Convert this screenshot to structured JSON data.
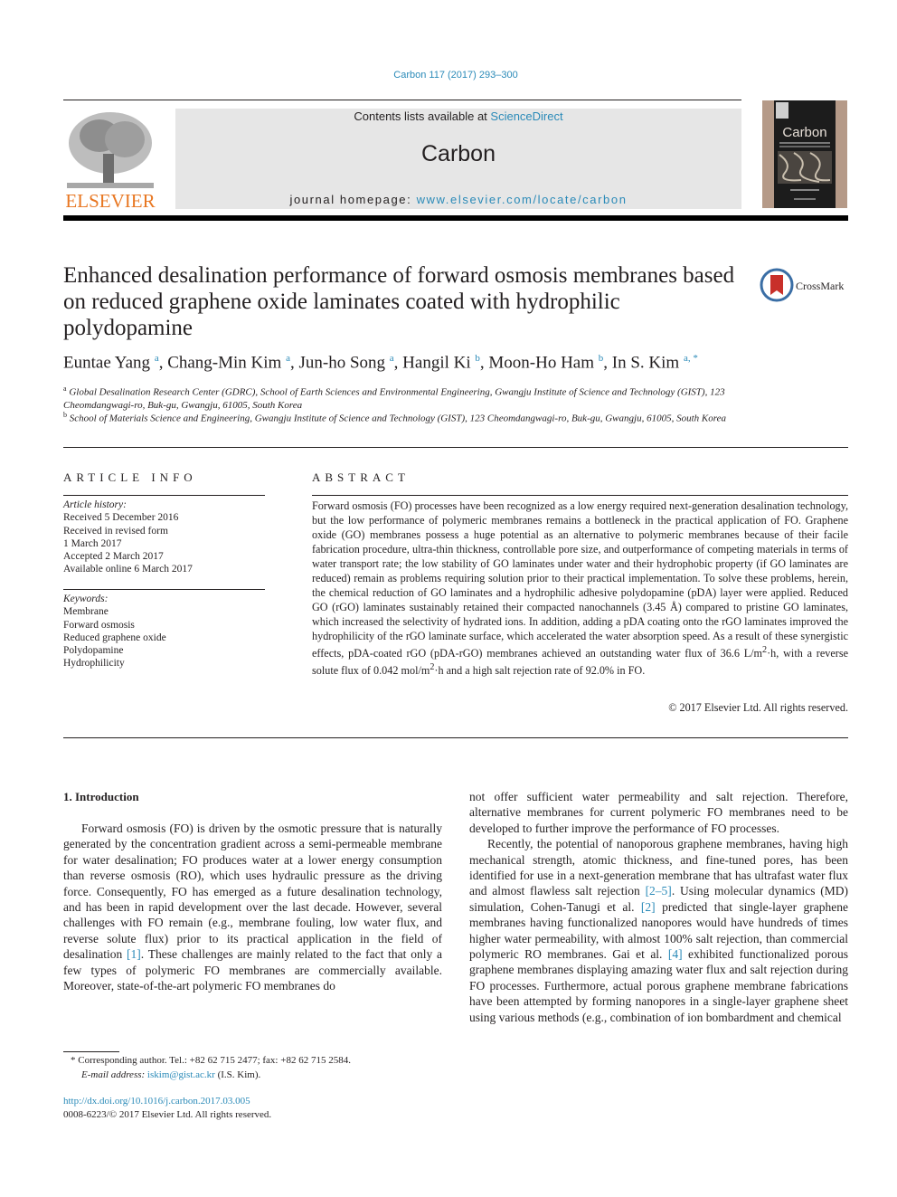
{
  "header": {
    "citation": "Carbon 117 (2017) 293–300",
    "contents_prefix": "Contents lists available at ",
    "contents_link": "ScienceDirect",
    "journal_name": "Carbon",
    "homepage_prefix": "journal homepage: ",
    "homepage_link": "www.elsevier.com/locate/carbon",
    "publisher": "ELSEVIER",
    "cover_title": "Carbon",
    "crossmark_label": "CrossMark"
  },
  "article": {
    "title": "Enhanced desalination performance of forward osmosis membranes based on reduced graphene oxide laminates coated with hydrophilic polydopamine",
    "authors": [
      {
        "name": "Euntae Yang",
        "aff": "a"
      },
      {
        "name": "Chang-Min Kim",
        "aff": "a"
      },
      {
        "name": "Jun-ho Song",
        "aff": "a"
      },
      {
        "name": "Hangil Ki",
        "aff": "b"
      },
      {
        "name": "Moon-Ho Ham",
        "aff": "b"
      },
      {
        "name": "In S. Kim",
        "aff": "a, *"
      }
    ],
    "affiliations": [
      {
        "key": "a",
        "text": "Global Desalination Research Center (GDRC), School of Earth Sciences and Environmental Engineering, Gwangju Institute of Science and Technology (GIST), 123 Cheomdangwagi-ro, Buk-gu, Gwangju, 61005, South Korea"
      },
      {
        "key": "b",
        "text": "School of Materials Science and Engineering, Gwangju Institute of Science and Technology (GIST), 123 Cheomdangwagi-ro, Buk-gu, Gwangju, 61005, South Korea"
      }
    ]
  },
  "article_info": {
    "heading": "ARTICLE INFO",
    "history_label": "Article history:",
    "history": [
      "Received 5 December 2016",
      "Received in revised form",
      "1 March 2017",
      "Accepted 2 March 2017",
      "Available online 6 March 2017"
    ],
    "keywords_label": "Keywords:",
    "keywords": [
      "Membrane",
      "Forward osmosis",
      "Reduced graphene oxide",
      "Polydopamine",
      "Hydrophilicity"
    ]
  },
  "abstract": {
    "heading": "ABSTRACT",
    "text_1": "Forward osmosis (FO) processes have been recognized as a low energy required next-generation desalination technology, but the low performance of polymeric membranes remains a bottleneck in the practical application of FO. Graphene oxide (GO) membranes possess a huge potential as an alternative to polymeric membranes because of their facile fabrication procedure, ultra-thin thickness, controllable pore size, and outperformance of competing materials in terms of water transport rate; the low stability of GO laminates under water and their hydrophobic property (if GO laminates are reduced) remain as problems requiring solution prior to their practical implementation. To solve these problems, herein, the chemical reduction of GO laminates and a hydrophilic adhesive polydopamine (pDA) layer were applied. Reduced GO (rGO) laminates sustainably retained their compacted nanochannels (3.45 Å) compared to pristine GO laminates, which increased the selectivity of hydrated ions. In addition, adding a pDA coating onto the rGO laminates improved the hydrophilicity of the rGO laminate surface, which accelerated the water absorption speed. As a result of these synergistic effects, pDA-coated rGO (pDA-rGO) membranes achieved an outstanding water flux of 36.6 L/m",
    "sup_1": "2",
    "text_2": "·h, with a reverse solute flux of 0.042 mol/m",
    "sup_2": "2",
    "text_3": "·h and a high salt rejection rate of 92.0% in FO.",
    "copyright": "© 2017 Elsevier Ltd. All rights reserved."
  },
  "body": {
    "section_heading": "1.  Introduction",
    "left_p1_a": "Forward osmosis (FO) is driven by the osmotic pressure that is naturally generated by the concentration gradient across a semi-permeable membrane for water desalination; FO produces water at a lower energy consumption than reverse osmosis (RO), which uses hydraulic pressure as the driving force. Consequently, FO has emerged as a future desalination technology, and has been in rapid development over the last decade. However, several challenges with FO remain (e.g., membrane fouling, low water flux, and reverse solute flux) prior to its practical application in the field of desalination ",
    "ref_1": "[1]",
    "left_p1_b": ". These challenges are mainly related to the fact that only a few types of polymeric FO membranes are commercially available. Moreover, state-of-the-art polymeric FO membranes do",
    "right_p1": "not offer sufficient water permeability and salt rejection. Therefore, alternative membranes for current polymeric FO membranes need to be developed to further improve the performance of FO processes.",
    "right_p2_a": "Recently, the potential of nanoporous graphene membranes, having high mechanical strength, atomic thickness, and fine-tuned pores, has been identified for use in a next-generation membrane that has ultrafast water flux and almost flawless salt rejection ",
    "ref_2_5": "[2–5]",
    "right_p2_b": ". Using molecular dynamics (MD) simulation, Cohen-Tanugi et al. ",
    "ref_2": "[2]",
    "right_p2_c": " predicted that single-layer graphene membranes having functionalized nanopores would have hundreds of times higher water permeability, with almost 100% salt rejection, than commercial polymeric RO membranes. Gai et al. ",
    "ref_4": "[4]",
    "right_p2_d": " exhibited functionalized porous graphene membranes displaying amazing water flux and salt rejection during FO processes. Furthermore, actual porous graphene membrane fabrications have been attempted by forming nanopores in a single-layer graphene sheet using various methods (e.g., combination of ion bombardment and chemical"
  },
  "footnote": {
    "star": "*",
    "corresponding": " Corresponding author. Tel.: +82 62 715 2477; fax: +82 62 715 2584.",
    "email_label": "E-mail address:",
    "email": "iskim@gist.ac.kr",
    "email_suffix": " (I.S. Kim).",
    "doi": "http://dx.doi.org/10.1016/j.carbon.2017.03.005",
    "issn": "0008-6223/© 2017 Elsevier Ltd. All rights reserved."
  }
}
